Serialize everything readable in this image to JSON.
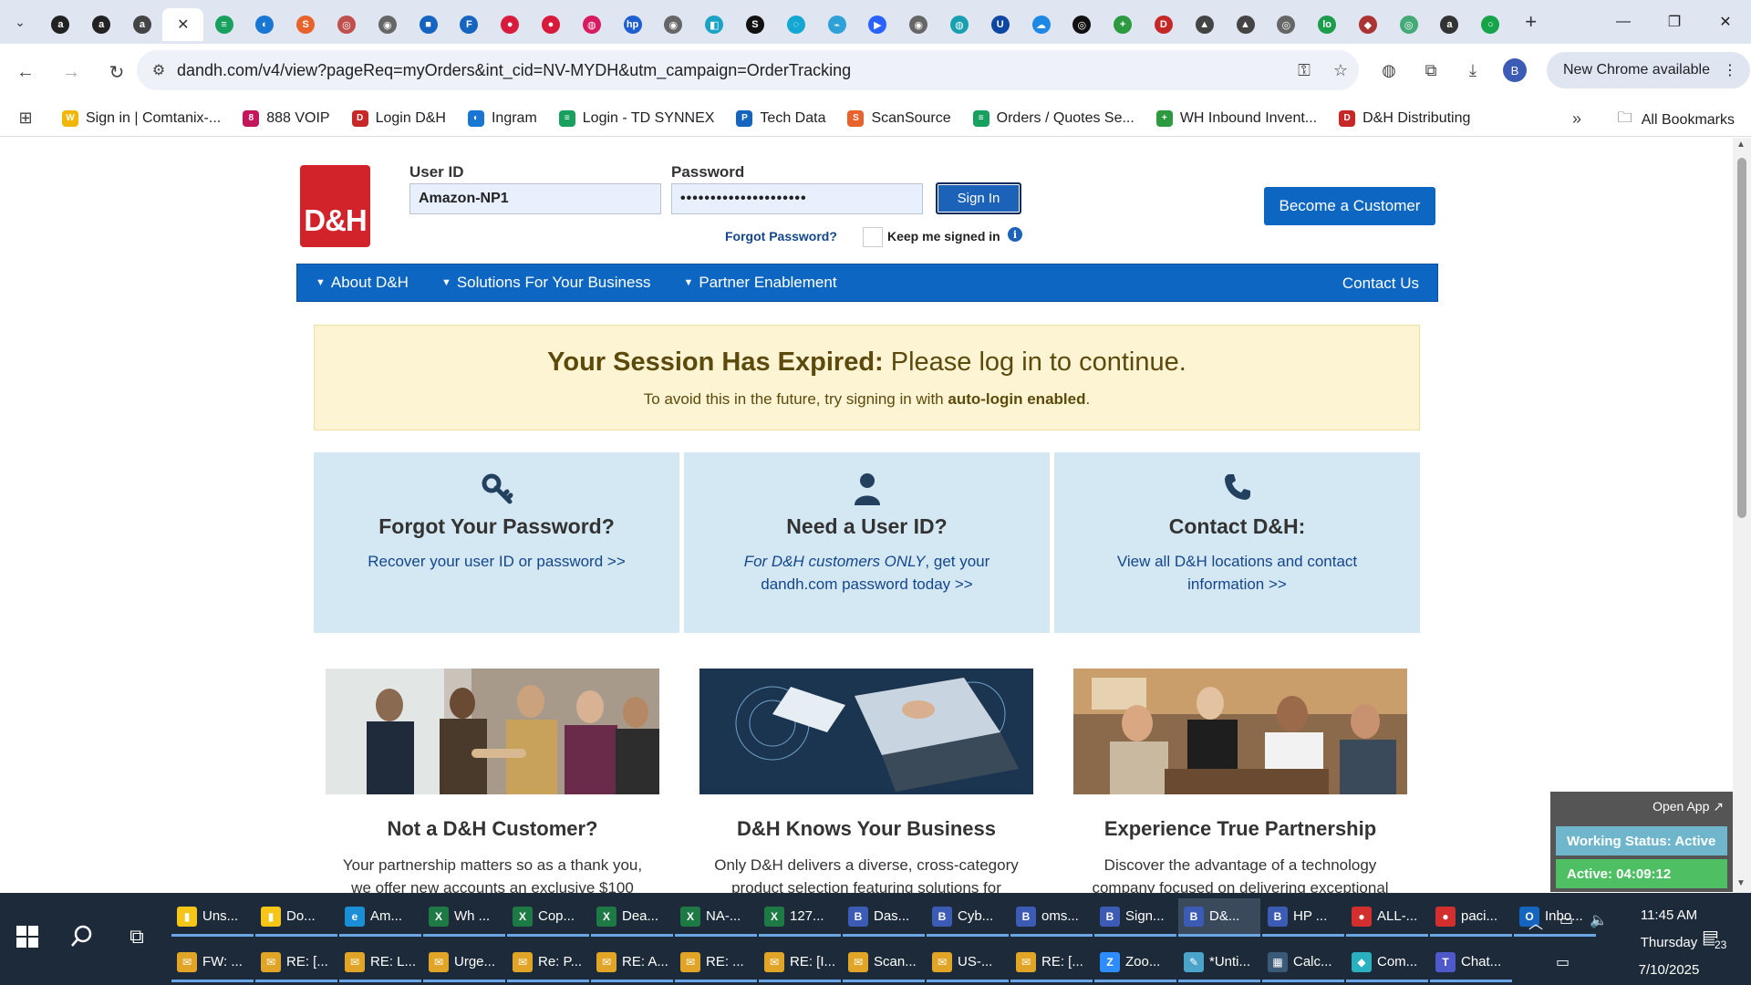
{
  "browser": {
    "active_tab_close": "✕",
    "new_tab": "+",
    "url": "dandh.com/v4/view?pageReq=myOrders&int_cid=NV-MYDH&utm_campaign=OrderTracking",
    "new_chrome": "New Chrome available",
    "avatar_letter": "B",
    "tabs": [
      {
        "glyph": "a",
        "color": "#222"
      },
      {
        "glyph": "a",
        "color": "#222"
      },
      {
        "glyph": "a",
        "color": "#444"
      },
      {
        "glyph": "",
        "color": "#fff",
        "active": true
      },
      {
        "glyph": "≡",
        "color": "#18a05e"
      },
      {
        "glyph": "◐",
        "color": "#1976d2"
      },
      {
        "glyph": "S",
        "color": "#e8622c"
      },
      {
        "glyph": "◎",
        "color": "#c0504d"
      },
      {
        "glyph": "◉",
        "color": "#666"
      },
      {
        "glyph": "■",
        "color": "#1565c0"
      },
      {
        "glyph": "F",
        "color": "#1565c0"
      },
      {
        "glyph": "●",
        "color": "#d81b3c"
      },
      {
        "glyph": "●",
        "color": "#d81b3c"
      },
      {
        "glyph": "◍",
        "color": "#d81b60"
      },
      {
        "glyph": "hp",
        "color": "#1e5fcf"
      },
      {
        "glyph": "◉",
        "color": "#666"
      },
      {
        "glyph": "◧",
        "color": "#1aa3c4"
      },
      {
        "glyph": "S",
        "color": "#111"
      },
      {
        "glyph": "◌",
        "color": "#13a7d1"
      },
      {
        "glyph": "⌁",
        "color": "#2fa0d8"
      },
      {
        "glyph": "▶",
        "color": "#2962ff"
      },
      {
        "glyph": "◉",
        "color": "#666"
      },
      {
        "glyph": "◍",
        "color": "#19a0b0"
      },
      {
        "glyph": "U",
        "color": "#0d47a1"
      },
      {
        "glyph": "☁",
        "color": "#1e88e5"
      },
      {
        "glyph": "◎",
        "color": "#111"
      },
      {
        "glyph": "+",
        "color": "#2e9a3f"
      },
      {
        "glyph": "D",
        "color": "#c62828"
      },
      {
        "glyph": "▲",
        "color": "#444"
      },
      {
        "glyph": "▲",
        "color": "#444"
      },
      {
        "glyph": "◎",
        "color": "#666"
      },
      {
        "glyph": "lo",
        "color": "#1b9e4b"
      },
      {
        "glyph": "◆",
        "color": "#a33"
      },
      {
        "glyph": "◎",
        "color": "#4a7"
      },
      {
        "glyph": "a",
        "color": "#333"
      },
      {
        "glyph": "○",
        "color": "#16a34a"
      }
    ],
    "bookmarks": [
      {
        "label": "Sign in | Comtanix-...",
        "glyph": "W",
        "color": "#f2b705"
      },
      {
        "label": "888 VOIP",
        "glyph": "8",
        "color": "#c2185b"
      },
      {
        "label": "Login D&H",
        "glyph": "D",
        "color": "#c62828"
      },
      {
        "label": "Ingram",
        "glyph": "◐",
        "color": "#1976d2"
      },
      {
        "label": "Login - TD SYNNEX",
        "glyph": "≡",
        "color": "#18a05e"
      },
      {
        "label": "Tech Data",
        "glyph": "P",
        "color": "#1565c0"
      },
      {
        "label": "ScanSource",
        "glyph": "S",
        "color": "#e8622c"
      },
      {
        "label": "Orders / Quotes Se...",
        "glyph": "≡",
        "color": "#18a05e"
      },
      {
        "label": "WH Inbound Invent...",
        "glyph": "+",
        "color": "#2e9a3f"
      },
      {
        "label": "D&H Distributing",
        "glyph": "D",
        "color": "#c62828"
      }
    ],
    "more_bookmarks": "»",
    "all_bookmarks": "All Bookmarks"
  },
  "login": {
    "logo_text": "D&H",
    "user_id_label": "User ID",
    "user_id_value": "Amazon-NP1",
    "password_label": "Password",
    "password_value": "•••••••••••••••••••••",
    "sign_in": "Sign In",
    "forgot_password": "Forgot Password?",
    "keep_signed_in": "Keep me signed in",
    "become_customer": "Become a Customer"
  },
  "nav": {
    "items": [
      "About D&H",
      "Solutions For Your Business",
      "Partner Enablement"
    ],
    "contact": "Contact Us"
  },
  "alert": {
    "heading_bold": "Your Session Has Expired:",
    "heading_rest": " Please log in to continue.",
    "sub_pre": "To avoid this in the future, try signing in with ",
    "sub_bold": "auto-login enabled",
    "sub_post": "."
  },
  "cards": [
    {
      "title": "Forgot Your Password?",
      "link": "Recover your user ID or password >>"
    },
    {
      "title": "Need a User ID?",
      "link_italic": "For D&H customers ONLY",
      "link": ", get your dandh.com password today >>"
    },
    {
      "title": "Contact D&H:",
      "link": "View all D&H locations and contact information >>"
    }
  ],
  "promos": [
    {
      "title": "Not a D&H Customer?",
      "desc": "Your partnership matters so as a thank you, we offer new accounts an exclusive $100"
    },
    {
      "title": "D&H Knows Your Business",
      "desc": "Only D&H delivers a diverse, cross-category product selection featuring solutions for"
    },
    {
      "title": "Experience True Partnership",
      "desc": "Discover the advantage of a technology company focused on delivering exceptional"
    }
  ],
  "widget": {
    "open_app": "Open App ↗",
    "working_status": "Working Status: Active",
    "active_time": "Active: 04:09:12"
  },
  "taskbar": {
    "row1": [
      {
        "label": "Uns...",
        "glyph": "▮",
        "color": "#f5c518"
      },
      {
        "label": "Do...",
        "glyph": "▮",
        "color": "#f5c518"
      },
      {
        "label": "Am...",
        "glyph": "e",
        "color": "#1a8fd6"
      },
      {
        "label": "Wh ...",
        "glyph": "X",
        "color": "#1d7a45"
      },
      {
        "label": "Cop...",
        "glyph": "X",
        "color": "#1d7a45"
      },
      {
        "label": "Dea...",
        "glyph": "X",
        "color": "#1d7a45"
      },
      {
        "label": "NA-...",
        "glyph": "X",
        "color": "#1d7a45"
      },
      {
        "label": "127...",
        "glyph": "X",
        "color": "#1d7a45"
      },
      {
        "label": "Das...",
        "glyph": "B",
        "color": "#3b5bb5"
      },
      {
        "label": "Cyb...",
        "glyph": "B",
        "color": "#3b5bb5"
      },
      {
        "label": "oms...",
        "glyph": "B",
        "color": "#3b5bb5"
      },
      {
        "label": "Sign...",
        "glyph": "B",
        "color": "#3b5bb5"
      },
      {
        "label": "D&...",
        "glyph": "B",
        "color": "#3b5bb5",
        "hl": true
      },
      {
        "label": "HP ...",
        "glyph": "B",
        "color": "#3b5bb5"
      },
      {
        "label": "ALL-...",
        "glyph": "●",
        "color": "#d32f2f"
      },
      {
        "label": "paci...",
        "glyph": "●",
        "color": "#d32f2f"
      },
      {
        "label": "Inbo...",
        "glyph": "O",
        "color": "#1565c0"
      }
    ],
    "row2": [
      {
        "label": "FW: ...",
        "glyph": "✉",
        "color": "#e0a526"
      },
      {
        "label": "RE: [...",
        "glyph": "✉",
        "color": "#e0a526"
      },
      {
        "label": "RE: L...",
        "glyph": "✉",
        "color": "#e0a526"
      },
      {
        "label": "Urge...",
        "glyph": "✉",
        "color": "#e0a526"
      },
      {
        "label": "Re: P...",
        "glyph": "✉",
        "color": "#e0a526"
      },
      {
        "label": "RE: A...",
        "glyph": "✉",
        "color": "#e0a526"
      },
      {
        "label": "RE: ...",
        "glyph": "✉",
        "color": "#e0a526"
      },
      {
        "label": "RE: [I...",
        "glyph": "✉",
        "color": "#e0a526"
      },
      {
        "label": "Scan...",
        "glyph": "✉",
        "color": "#e0a526"
      },
      {
        "label": "US-...",
        "glyph": "✉",
        "color": "#e0a526"
      },
      {
        "label": "RE: [...",
        "glyph": "✉",
        "color": "#e0a526"
      },
      {
        "label": "Zoo...",
        "glyph": "Z",
        "color": "#2d8cff"
      },
      {
        "label": "*Unti...",
        "glyph": "✎",
        "color": "#4aa3c8"
      },
      {
        "label": "Calc...",
        "glyph": "▦",
        "color": "#3a5a78"
      },
      {
        "label": "Com...",
        "glyph": "◆",
        "color": "#2bb0c0"
      },
      {
        "label": "Chat...",
        "glyph": "T",
        "color": "#5059c9"
      }
    ],
    "time": "11:45 AM",
    "day": "Thursday",
    "date": "7/10/2025",
    "notif_count": "23"
  }
}
